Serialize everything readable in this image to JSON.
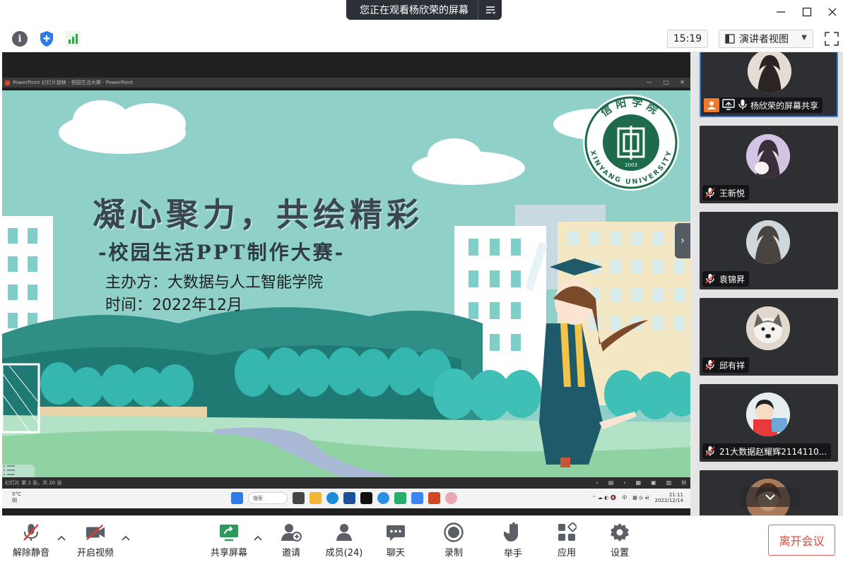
{
  "window": {
    "share_banner": "您正在观看杨欣荣的屏幕",
    "minimize_icon": "minimize-icon",
    "maximize_icon": "maximize-icon",
    "close_icon": "close-icon"
  },
  "top_toolbar": {
    "info_label": "i",
    "clock": "15:19",
    "view_mode": "演讲者视图"
  },
  "slide": {
    "title": "凝心聚力，共绘精彩",
    "subtitle": "-校园生活PPT制作大赛-",
    "organizer": "主办方：大数据与人工智能学院",
    "date": "时间：2022年12月",
    "logo_top_text": "信阳学院",
    "logo_bottom_text": "XINYANG UNIVERSITY",
    "logo_year": "2003",
    "window_title": "PowerPoint 幻灯片放映 - 校园生活大赛 - PowerPoint",
    "status_text": "幻灯片 第 2 张，共 20 张",
    "taskbar_weather_temp": "5°C",
    "taskbar_weather_desc": "阴",
    "taskbar_search": "搜索",
    "taskbar_ime": "中",
    "taskbar_time": "21:11",
    "taskbar_date": "2022/12/14"
  },
  "participants": [
    {
      "name": "杨欣荣的屏幕共享",
      "avatar_color": "#d9d2cc",
      "sharing": true
    },
    {
      "name": "王新悦",
      "avatar_color": "#c9b7d8",
      "sharing": false
    },
    {
      "name": "袁锦昇",
      "avatar_color": "#cdd5dc",
      "sharing": false
    },
    {
      "name": "邱有祥",
      "avatar_color": "#d8d0c4",
      "sharing": false
    },
    {
      "name": "21大数据赵耀辉2114110...",
      "avatar_color": "#cfe0e6",
      "sharing": false
    },
    {
      "name": "",
      "avatar_color": "#b58a6a",
      "sharing": false
    }
  ],
  "bottom_toolbar": {
    "unmute": "解除静音",
    "start_video": "开启视频",
    "share_screen": "共享屏幕",
    "invite": "邀请",
    "members": "成员(24)",
    "chat": "聊天",
    "record": "录制",
    "raise_hand": "举手",
    "apps": "应用",
    "settings": "设置",
    "leave": "离开会议"
  },
  "colors": {
    "accent_blue": "#3a7bd5",
    "leave_red": "#e0453c",
    "share_green": "#2b9a5b",
    "slide_teal": "#8dd0c8"
  }
}
